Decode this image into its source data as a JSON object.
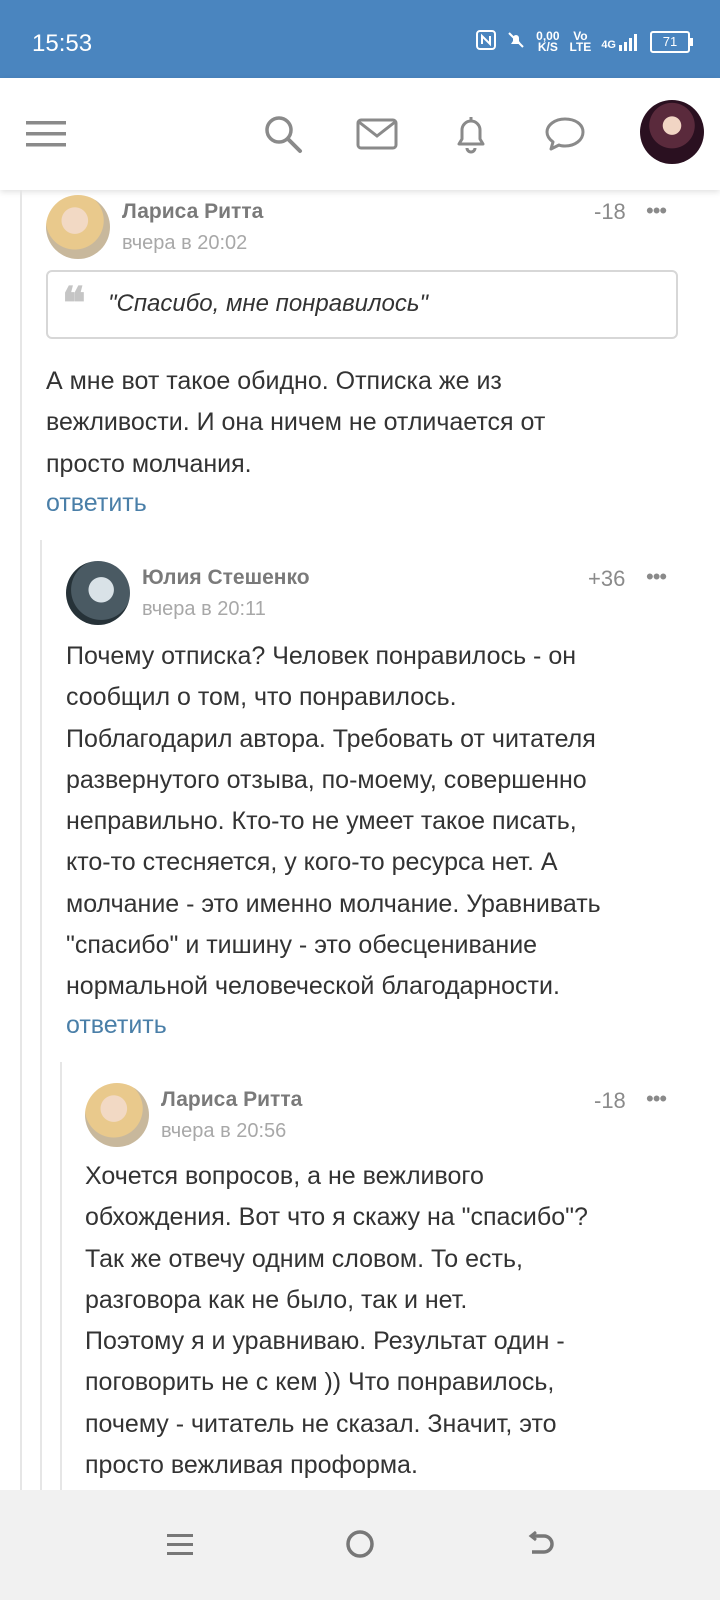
{
  "status_bar": {
    "time": "15:53",
    "net_speed_value": "0,00",
    "net_speed_unit": "K/S",
    "volte_top": "Vo",
    "volte_bottom": "LTE",
    "signal_label": "4G",
    "battery": "71"
  },
  "header": {
    "icons": [
      "menu-icon",
      "search-icon",
      "mail-icon",
      "bell-icon",
      "chat-icon"
    ]
  },
  "comments": [
    {
      "author": "Лариса Ритта",
      "time": "вчера в 20:02",
      "score": "-18",
      "more": "•••",
      "quote": "\"Спасибо, мне понравилось\"",
      "quote_mark": "❝",
      "lines": [
        "А мне вот такое обидно. Отписка же из",
        "вежливости. И она ничем не отличается от",
        "просто молчания."
      ],
      "reply": "ответить"
    },
    {
      "author": "Юлия Стешенко",
      "time": "вчера в 20:11",
      "score": "+36",
      "more": "•••",
      "lines": [
        "Почему отписка? Человек понравилось - он",
        "сообщил о том, что понравилось.",
        "Поблагодарил автора. Требовать от читателя",
        "развернутого отзыва, по-моему, совершенно",
        "неправильно. Кто-то не умеет такое писать,",
        "кто-то стесняется, у кого-то ресурса нет. А",
        "молчание - это именно молчание. Уравнивать",
        "\"спасибо\" и тишину - это обесценивание",
        "нормальной человеческой благодарности."
      ],
      "reply": "ответить"
    },
    {
      "author": "Лариса Ритта",
      "time": "вчера в 20:56",
      "score": "-18",
      "more": "•••",
      "lines": [
        "Хочется вопросов, а не вежливого",
        "обхождения. Вот что я скажу на \"спасибо\"?",
        "Так же отвечу одним словом. То есть,",
        "разговора как не было, так и нет.",
        "Поэтому я и уравниваю. Результат один -",
        "поговорить не с кем )) Что понравилось,",
        "почему - читатель не сказал. Значит, это",
        "просто вежливая проформа."
      ]
    }
  ],
  "nav_bar": {
    "icons": [
      "recent-apps-icon",
      "home-icon",
      "back-icon"
    ]
  },
  "colors": {
    "status_bar": "#4a85bf",
    "reply_link": "#4a7fa8",
    "text": "#333333"
  }
}
